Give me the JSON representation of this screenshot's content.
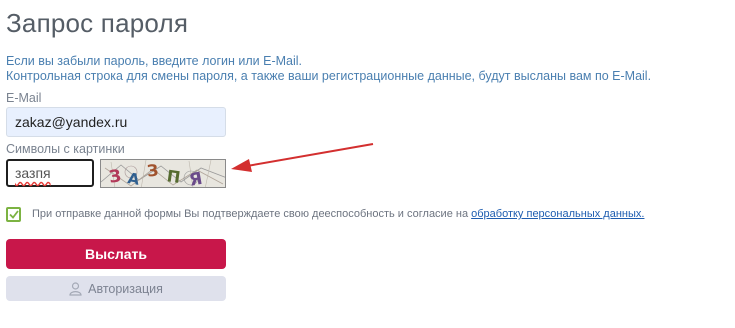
{
  "page": {
    "title": "Запрос пароля",
    "desc_line1": "Если вы забыли пароль, введите логин или E-Mail.",
    "desc_line2": "Контрольная строка для смены пароля, а также ваши регистрационные данные, будут высланы вам по E-Mail."
  },
  "form": {
    "email_label": "E-Mail",
    "email_value": "zakaz@yandex.ru",
    "captcha_label": "Символы с картинки",
    "captcha_value": "зазпя",
    "captcha_image_text": "ЗАЗПЯ",
    "consent_text": "При отправке данной формы Вы подтверждаете свою дееспособность и согласие на ",
    "consent_link": "обработку персональных данных.",
    "consent_checked": true,
    "submit_label": "Выслать",
    "auth_label": "Авторизация"
  },
  "icons": {
    "checkbox": "check-icon",
    "auth": "user-icon",
    "annotation": "red-arrow-icon"
  },
  "colors": {
    "accent": "#c8174a",
    "link": "#1e5db0",
    "checkbox": "#7cb342",
    "arrow": "#d32f2f"
  }
}
